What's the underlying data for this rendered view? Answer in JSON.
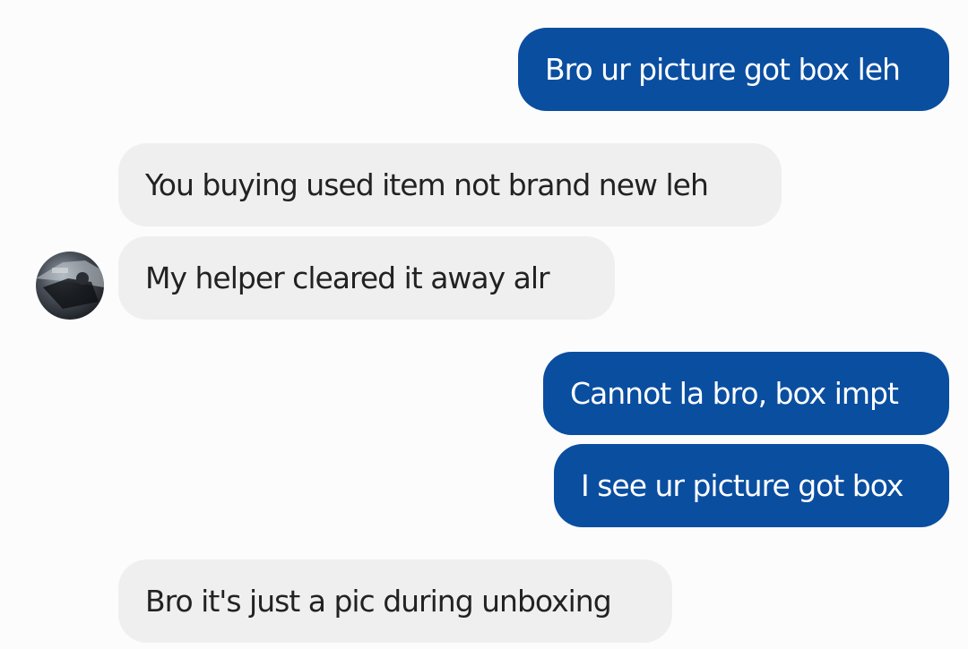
{
  "conversation": {
    "messages": [
      {
        "direction": "outgoing",
        "text": "Bro ur picture got box leh"
      },
      {
        "direction": "incoming",
        "text": "You buying used item not brand new leh"
      },
      {
        "direction": "incoming",
        "text": "My helper cleared it away alr"
      },
      {
        "direction": "outgoing",
        "text": "Cannot la bro, box impt"
      },
      {
        "direction": "outgoing",
        "text": "I see ur picture got box"
      },
      {
        "direction": "incoming",
        "text": "Bro it's just a pic during unboxing"
      }
    ]
  },
  "colors": {
    "outgoing_bubble": "#0a4ea0",
    "incoming_bubble": "#efefef",
    "background": "#fcfcfc"
  },
  "icons": {
    "sender_avatar": "avatar-photo"
  }
}
